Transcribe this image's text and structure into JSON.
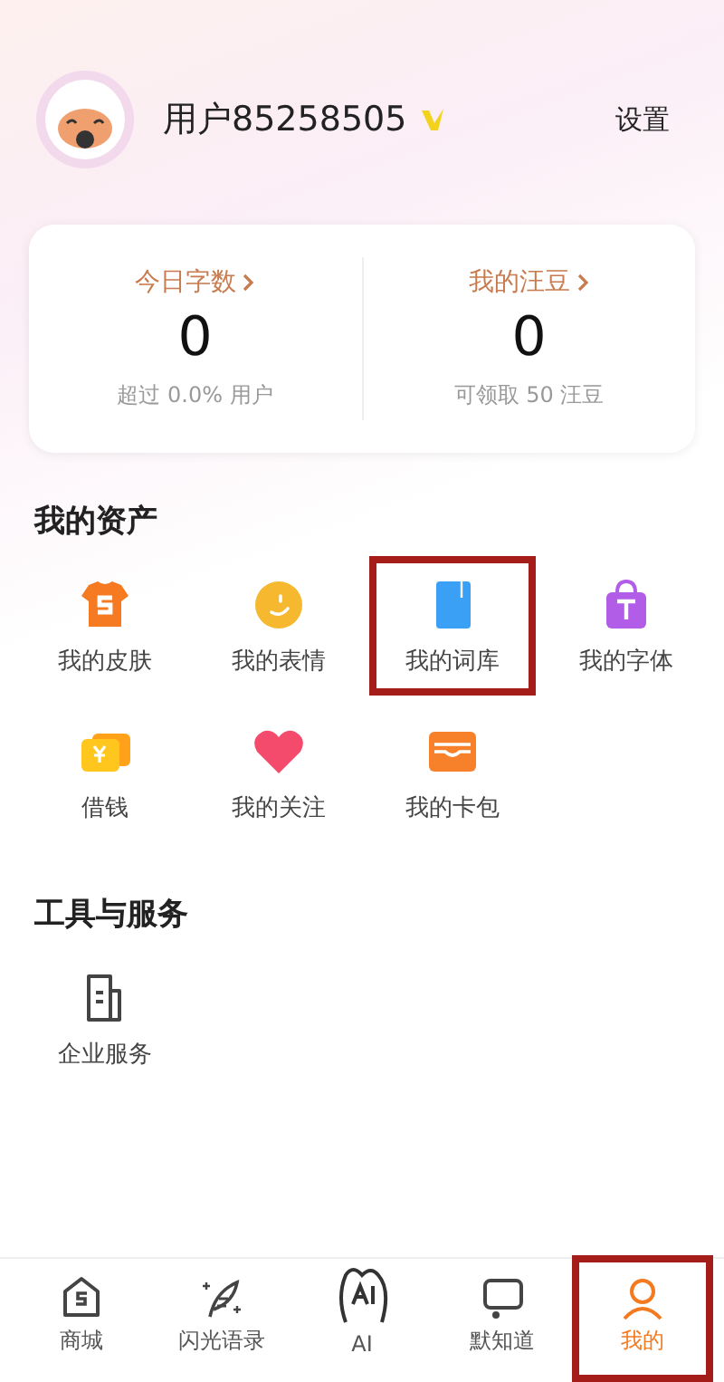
{
  "profile": {
    "username": "用户85258505",
    "settings": "设置"
  },
  "stats": [
    {
      "title": "今日字数",
      "value": "0",
      "note": "超过 0.0% 用户"
    },
    {
      "title": "我的汪豆",
      "value": "0",
      "note": "可领取 50 汪豆"
    }
  ],
  "assets": {
    "title": "我的资产",
    "items": [
      {
        "kind": "skin",
        "label": "我的皮肤",
        "highlighted": false
      },
      {
        "kind": "emoji",
        "label": "我的表情",
        "highlighted": false
      },
      {
        "kind": "lexicon",
        "label": "我的词库",
        "highlighted": true
      },
      {
        "kind": "font",
        "label": "我的字体",
        "highlighted": false
      },
      {
        "kind": "loan",
        "label": "借钱",
        "highlighted": false
      },
      {
        "kind": "follow",
        "label": "我的关注",
        "highlighted": false
      },
      {
        "kind": "wallet",
        "label": "我的卡包",
        "highlighted": false
      }
    ]
  },
  "tools": {
    "title": "工具与服务",
    "items": [
      {
        "kind": "enterprise",
        "label": "企业服务"
      }
    ]
  },
  "tab_bar": [
    {
      "kind": "shop",
      "label": "商城",
      "selected": false,
      "highlighted": false
    },
    {
      "kind": "quill",
      "label": "闪光语录",
      "selected": false,
      "highlighted": false
    },
    {
      "kind": "ai",
      "label": "AI",
      "selected": false,
      "highlighted": false
    },
    {
      "kind": "chat",
      "label": "默知道",
      "selected": false,
      "highlighted": false
    },
    {
      "kind": "me",
      "label": "我的",
      "selected": true,
      "highlighted": true
    }
  ]
}
